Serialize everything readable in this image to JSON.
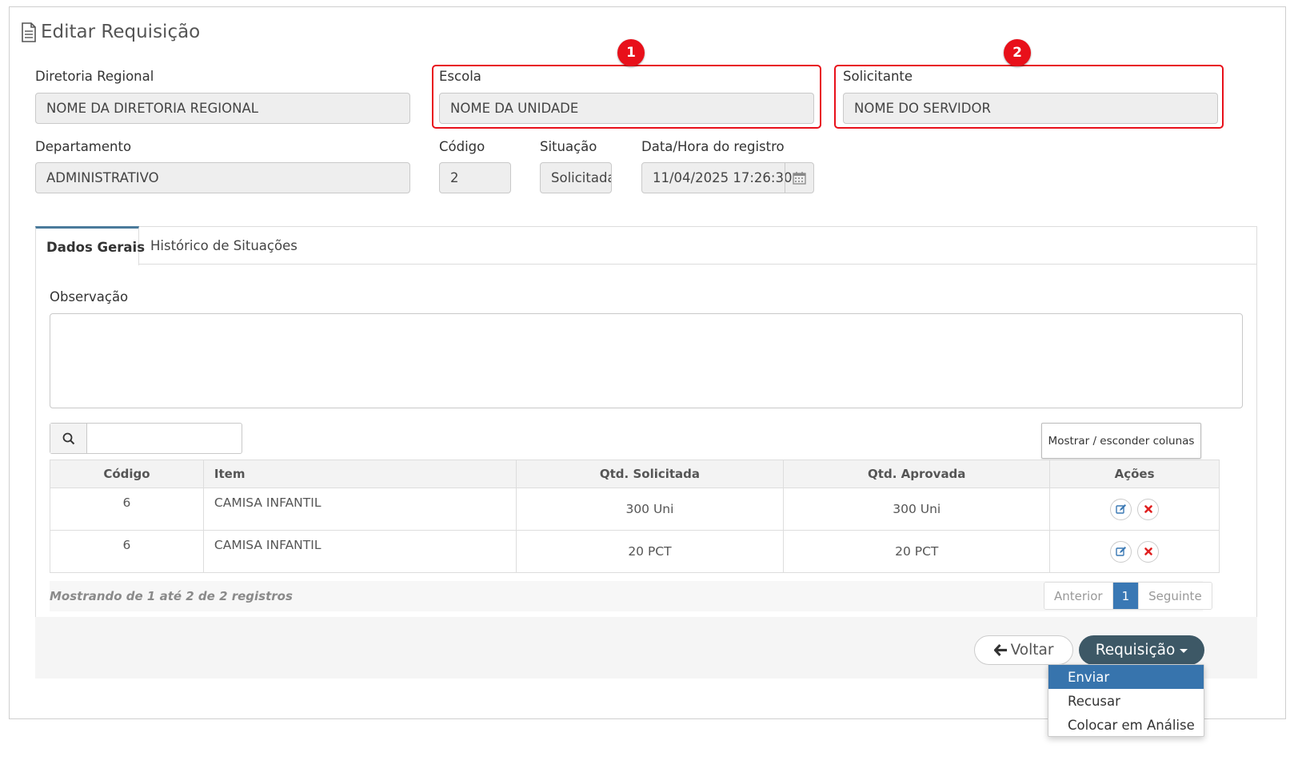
{
  "page": {
    "title": "Editar Requisição"
  },
  "form": {
    "diretoria_label": "Diretoria Regional",
    "diretoria_value": "NOME DA DIRETORIA REGIONAL",
    "escola_label": "Escola",
    "escola_value": "NOME DA UNIDADE",
    "solicitante_label": "Solicitante",
    "solicitante_value": "NOME DO SERVIDOR",
    "departamento_label": "Departamento",
    "departamento_value": "ADMINISTRATIVO",
    "codigo_label": "Código",
    "codigo_value": "2",
    "situacao_label": "Situação",
    "situacao_value": "Solicitada",
    "data_label": "Data/Hora do registro",
    "data_value": "11/04/2025 17:26:30"
  },
  "badges": [
    "1",
    "2"
  ],
  "tabs": [
    {
      "label": "Dados Gerais",
      "active": true
    },
    {
      "label": "Histórico de Situações",
      "active": false
    }
  ],
  "observacao": {
    "label": "Observação",
    "value": ""
  },
  "table": {
    "search_value": "",
    "toggle_columns_label": "Mostrar / esconder colunas",
    "columns": [
      "Código",
      "Item",
      "Qtd. Solicitada",
      "Qtd. Aprovada",
      "Ações"
    ],
    "rows": [
      {
        "codigo": "6",
        "item": "CAMISA INFANTIL",
        "qtd_solicitada": "300 Uni",
        "qtd_aprovada": "300 Uni"
      },
      {
        "codigo": "6",
        "item": "CAMISA INFANTIL",
        "qtd_solicitada": "20 PCT",
        "qtd_aprovada": "20 PCT"
      }
    ],
    "info": "Mostrando de 1 até 2 de 2 registros",
    "pager": {
      "prev": "Anterior",
      "current": "1",
      "next": "Seguinte"
    }
  },
  "actions": {
    "voltar": "Voltar",
    "requisicao": "Requisição",
    "menu": [
      "Enviar",
      "Recusar",
      "Colocar em Análise"
    ]
  },
  "colors": {
    "highlight": "#e8101a",
    "primary_button": "#3d5866",
    "menu_selected": "#3774ad",
    "pager_active": "#3a78b4"
  },
  "icons": [
    "document-icon",
    "calendar-icon",
    "search-icon",
    "edit-icon",
    "delete-icon",
    "arrow-left-icon",
    "caret-down-icon"
  ]
}
